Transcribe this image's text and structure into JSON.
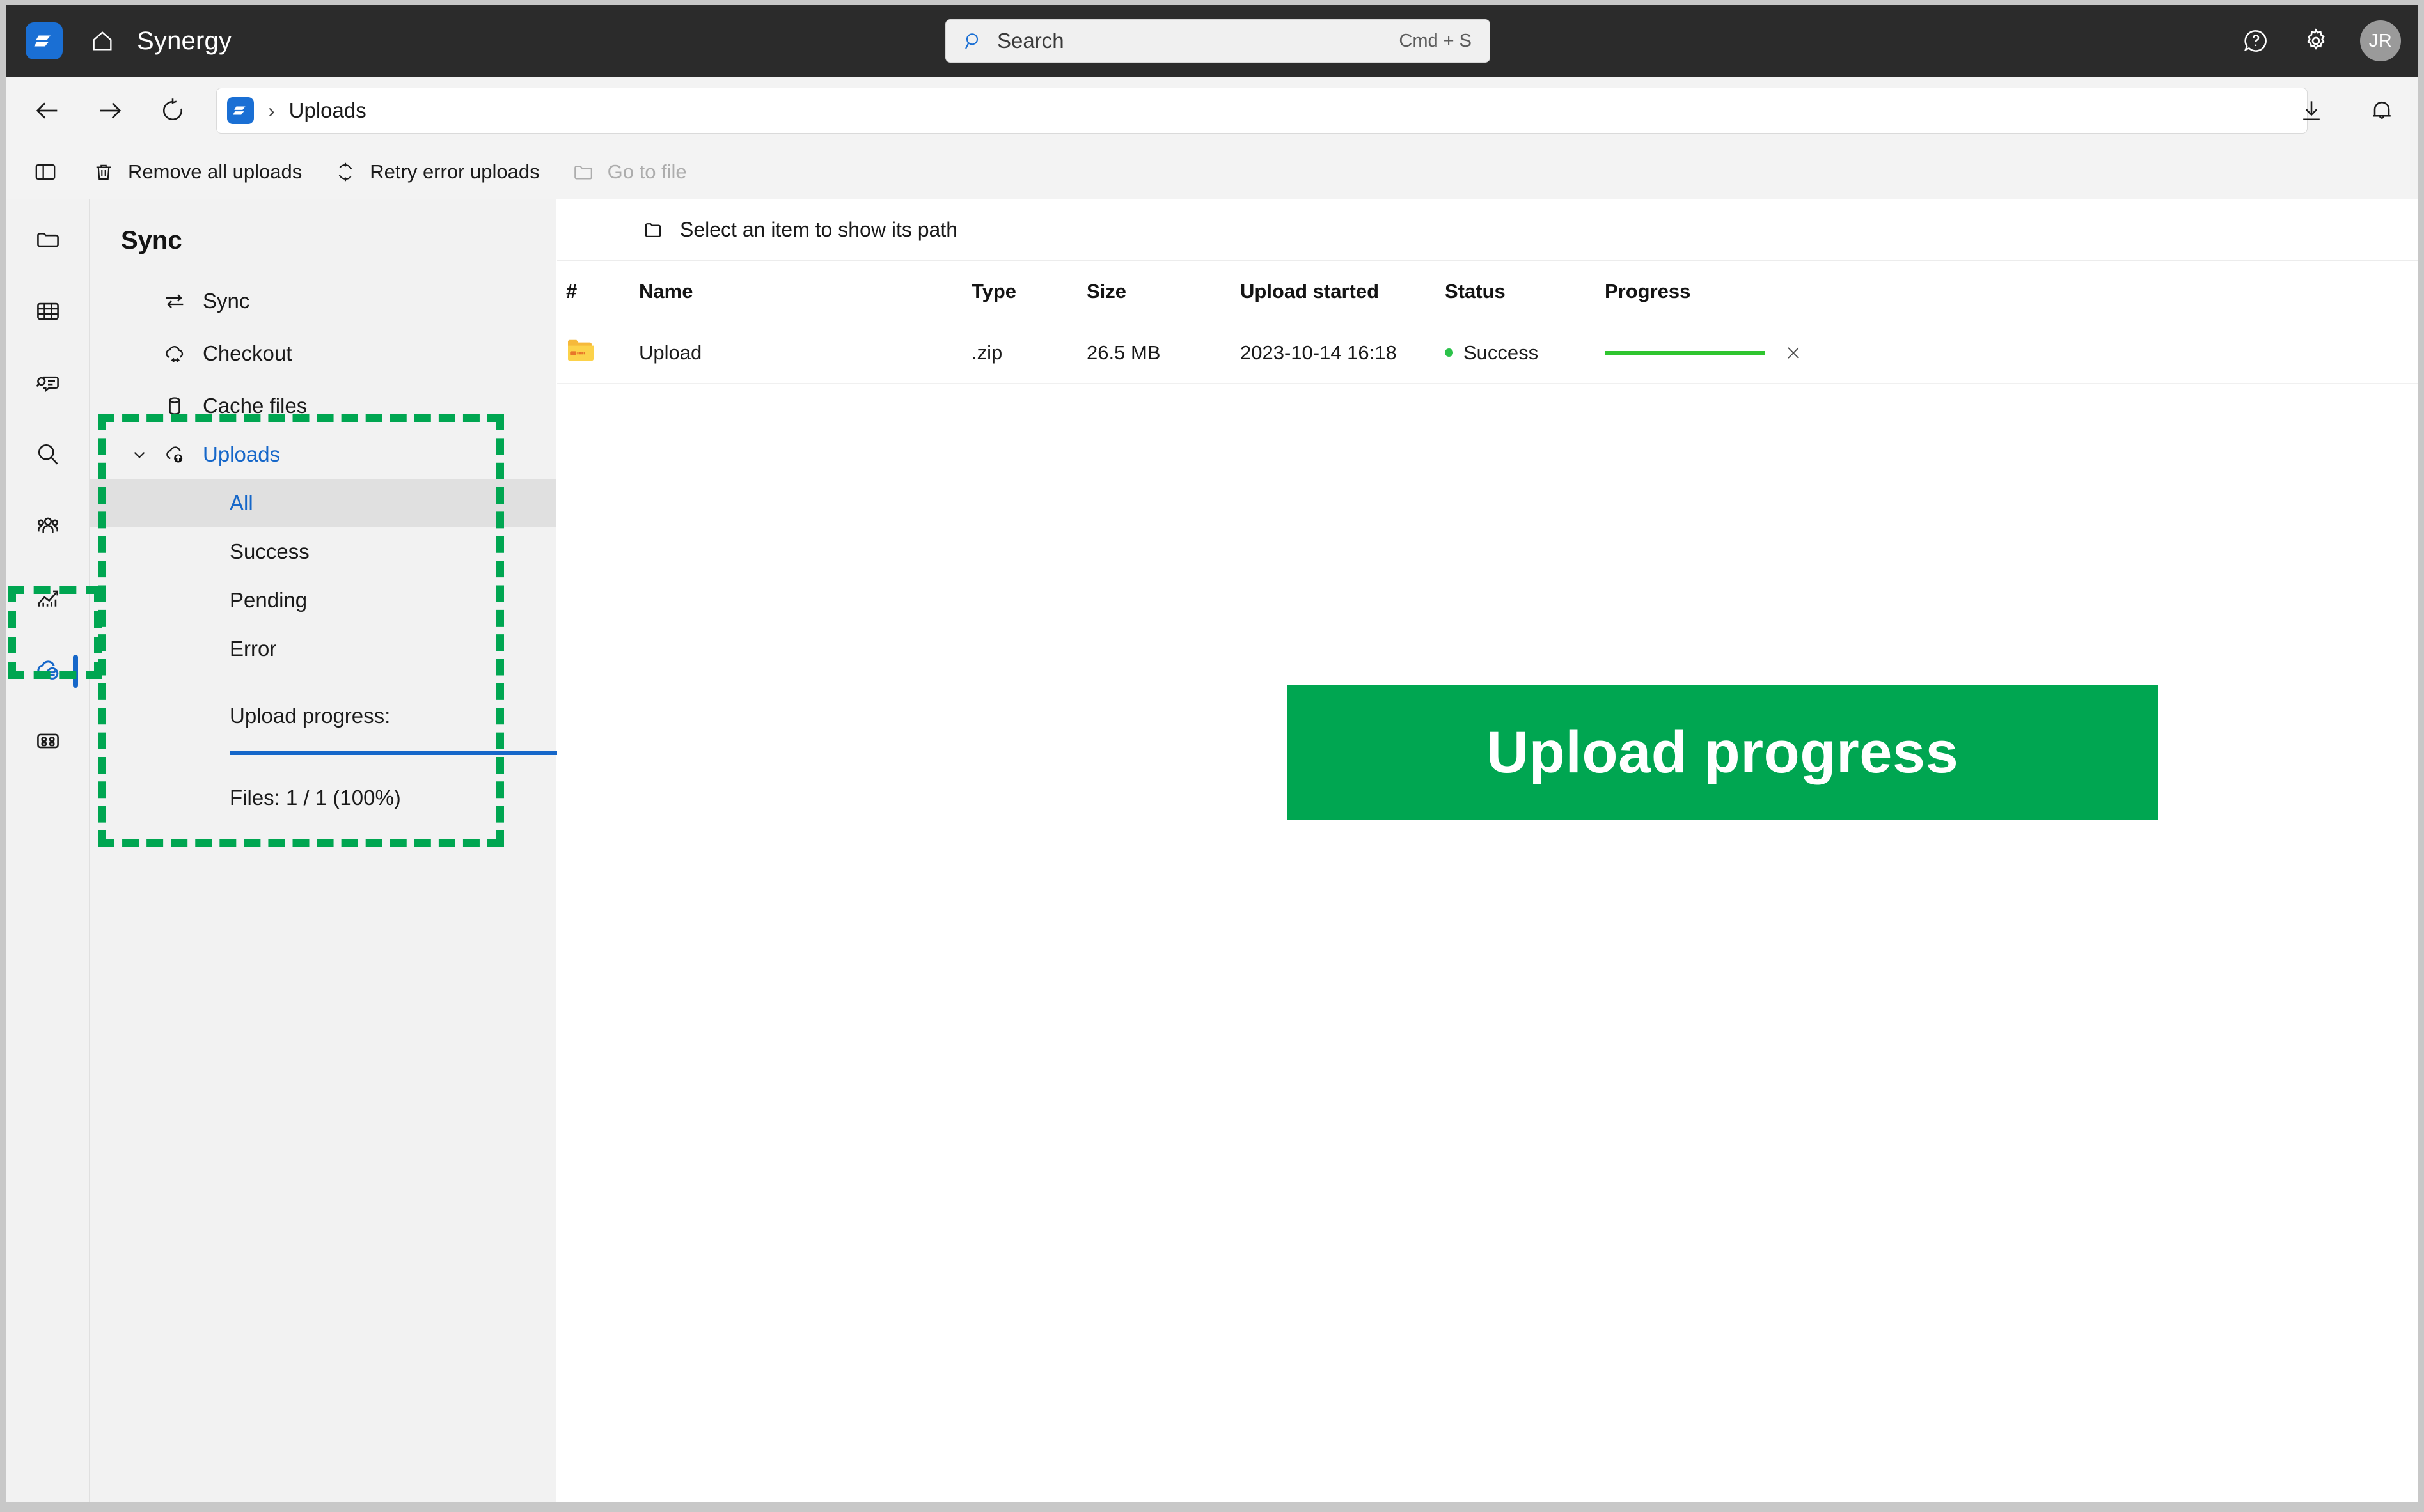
{
  "titlebar": {
    "app_logo": "synergy-logo-icon",
    "home_icon": "home-icon",
    "title": "Synergy",
    "help_icon": "help-icon",
    "settings_icon": "gear-icon",
    "avatar_initials": "JR"
  },
  "search": {
    "icon": "search-icon",
    "placeholder": "Search",
    "shortcut": "Cmd + S"
  },
  "navbar": {
    "back_icon": "arrow-left-icon",
    "forward_icon": "arrow-right-icon",
    "reload_icon": "refresh-icon",
    "address_logo": "synergy-logo-icon",
    "separator": "›",
    "breadcrumb": "Uploads",
    "download_icon": "download-icon",
    "bell_icon": "bell-icon"
  },
  "commandbar": {
    "pane_icon": "layout-pane-icon",
    "buttons": [
      {
        "icon": "trash-icon",
        "label": "Remove all uploads",
        "disabled": false
      },
      {
        "icon": "retry-icon",
        "label": "Retry error uploads",
        "disabled": false
      },
      {
        "icon": "folder-open-icon",
        "label": "Go to file",
        "disabled": true
      }
    ]
  },
  "rail": {
    "items": [
      {
        "icon": "folder-icon",
        "selected": false
      },
      {
        "icon": "table-grid-icon",
        "selected": false
      },
      {
        "icon": "comment-search-icon",
        "selected": false
      },
      {
        "icon": "search-icon",
        "selected": false
      },
      {
        "icon": "people-icon",
        "selected": false
      },
      {
        "icon": "chart-trend-icon",
        "selected": false
      },
      {
        "icon": "cloud-sync-icon",
        "selected": true
      },
      {
        "icon": "apps-grid-icon",
        "selected": false
      }
    ]
  },
  "sidebar": {
    "title": "Sync",
    "items": [
      {
        "icon": "sync-arrows-icon",
        "label": "Sync"
      },
      {
        "icon": "cloud-checkout-icon",
        "label": "Checkout"
      },
      {
        "icon": "database-icon",
        "label": "Cache files"
      }
    ],
    "group": {
      "chevron_icon": "chevron-down-icon",
      "icon": "cloud-upload-icon",
      "label": "Uploads",
      "children": [
        {
          "label": "All",
          "active": true
        },
        {
          "label": "Success",
          "active": false
        },
        {
          "label": "Pending",
          "active": false
        },
        {
          "label": "Error",
          "active": false
        }
      ]
    },
    "progress_label": "Upload progress:",
    "progress_percent": 100,
    "files_text": "Files: 1 / 1 (100%)"
  },
  "content": {
    "pathbar": {
      "icon": "folder-icon",
      "text": "Select an item to show its path"
    },
    "table": {
      "columns": [
        "#",
        "Name",
        "Type",
        "Size",
        "Upload started",
        "Status",
        "Progress"
      ],
      "rows": [
        {
          "num": "",
          "icon": "zip-folder-icon",
          "name": "Upload",
          "type": ".zip",
          "size": "26.5 MB",
          "upload_started": "2023-10-14 16:18",
          "status": "Success",
          "status_color": "#2bc24a",
          "progress_percent": 100,
          "cancel_icon": "close-icon"
        }
      ]
    },
    "banner": {
      "text": "Upload progress",
      "color": "#00a651"
    }
  },
  "annotations": {
    "color": "#00a651",
    "boxes": [
      "sidebar-uploads-section",
      "rail-cloud-sync-item"
    ]
  }
}
